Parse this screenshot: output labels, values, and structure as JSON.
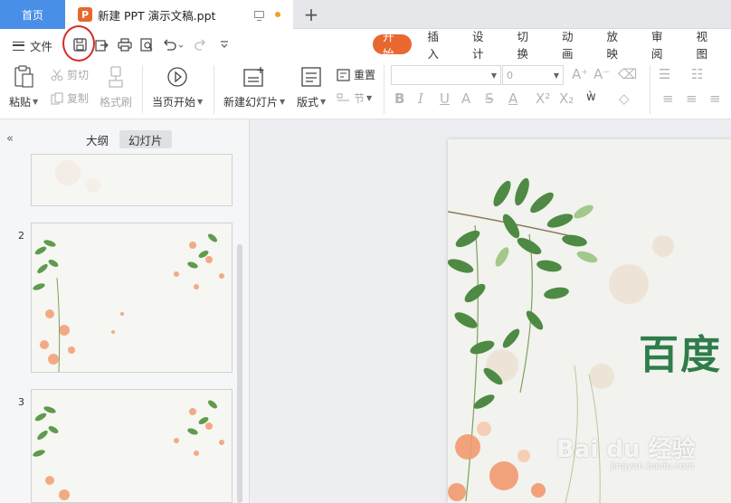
{
  "tabs": {
    "home": "首页",
    "document": "新建 PPT 演示文稿.ppt",
    "doc_badge": "P",
    "add": "+"
  },
  "menu": {
    "file_label": "文件"
  },
  "quick_access_icons": [
    "save-icon",
    "export-icon",
    "print-icon",
    "print-preview-icon",
    "undo-icon",
    "redo-icon",
    "customize-icon"
  ],
  "ribbon_tabs": [
    {
      "label": "开始",
      "active": true
    },
    {
      "label": "插入"
    },
    {
      "label": "设计"
    },
    {
      "label": "切换"
    },
    {
      "label": "动画"
    },
    {
      "label": "放映"
    },
    {
      "label": "审阅"
    },
    {
      "label": "视图"
    }
  ],
  "ribbon": {
    "paste": "粘贴",
    "cut": "剪切",
    "copy": "复制",
    "format_painter": "格式刷",
    "play_from_current": "当页开始",
    "new_slide": "新建幻灯片",
    "layout": "版式",
    "reset": "重置",
    "section": "节",
    "font_size_value": "0"
  },
  "panel": {
    "collapse": "«",
    "tab_outline": "大纲",
    "tab_slides": "幻灯片",
    "slide_numbers": [
      "2",
      "3"
    ]
  },
  "slide": {
    "title": "百度",
    "watermark": "Bai du 经验",
    "watermark_sub": "jingyan.baidu.com"
  },
  "colors": {
    "accent": "#e8682f",
    "home_tab": "#4a8fe7",
    "title_green": "#2e7d4a",
    "highlight_red": "#d52a2a"
  }
}
